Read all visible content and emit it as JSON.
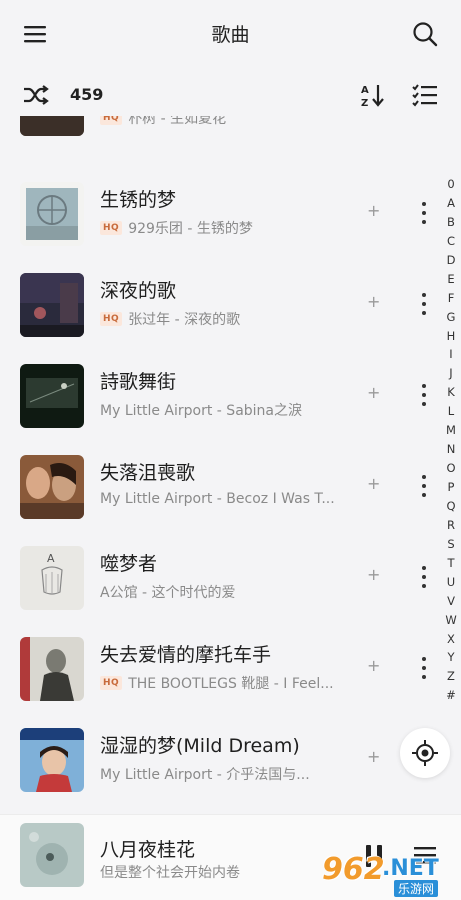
{
  "header": {
    "title": "歌曲"
  },
  "toolbar": {
    "count": "459"
  },
  "songs": [
    {
      "title": "",
      "subtitle": "朴树 - 生如夏花",
      "hq": true
    },
    {
      "title": "生锈的梦",
      "subtitle": "929乐团 - 生锈的梦",
      "hq": true
    },
    {
      "title": "深夜的歌",
      "subtitle": "张过年 - 深夜的歌",
      "hq": true
    },
    {
      "title": "詩歌舞街",
      "subtitle": "My Little Airport - Sabina之淚",
      "hq": false
    },
    {
      "title": "失落沮喪歌",
      "subtitle": "My Little Airport - Becoz I Was T...",
      "hq": false
    },
    {
      "title": "噬梦者",
      "subtitle": "A公馆 - 这个时代的爱",
      "hq": false
    },
    {
      "title": "失去爱情的摩托车手",
      "subtitle": "THE BOOTLEGS 靴腿 - I Feel...",
      "hq": true
    },
    {
      "title": "湿湿的梦(Mild Dream)",
      "subtitle": "My Little Airport - 介乎法国与...",
      "hq": false
    }
  ],
  "hq_label": "HQ",
  "plus_label": "+",
  "alphabet": [
    "0",
    "A",
    "B",
    "C",
    "D",
    "E",
    "F",
    "G",
    "H",
    "I",
    "J",
    "K",
    "L",
    "M",
    "N",
    "O",
    "P",
    "Q",
    "R",
    "S",
    "T",
    "U",
    "V",
    "W",
    "X",
    "Y",
    "Z",
    "#"
  ],
  "now_playing": {
    "title": "八月夜桂花",
    "subtitle": "但是整个社会开始内卷"
  },
  "watermark": {
    "digits": "962",
    "suffix": ".NET",
    "site": "乐游网"
  },
  "colors": {
    "accent_hq": "#c86b3c",
    "background": "#f4f4f6"
  }
}
